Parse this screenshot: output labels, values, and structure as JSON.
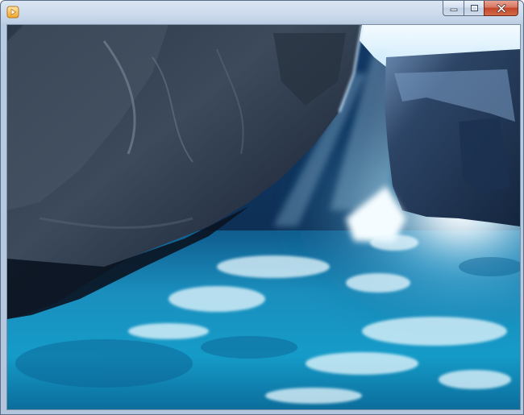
{
  "window": {
    "title": "",
    "app_icon": "media-player-icon",
    "caption_buttons": {
      "minimize_icon": "minimize-icon",
      "maximize_icon": "maximize-icon",
      "close_icon": "close-icon"
    }
  },
  "video": {
    "scene": "sea-cave"
  },
  "colors": {
    "titlebar": "#c6d6ea",
    "close_button": "#c2452a",
    "water": "#1fa0c8",
    "rock": "#2a3848"
  }
}
